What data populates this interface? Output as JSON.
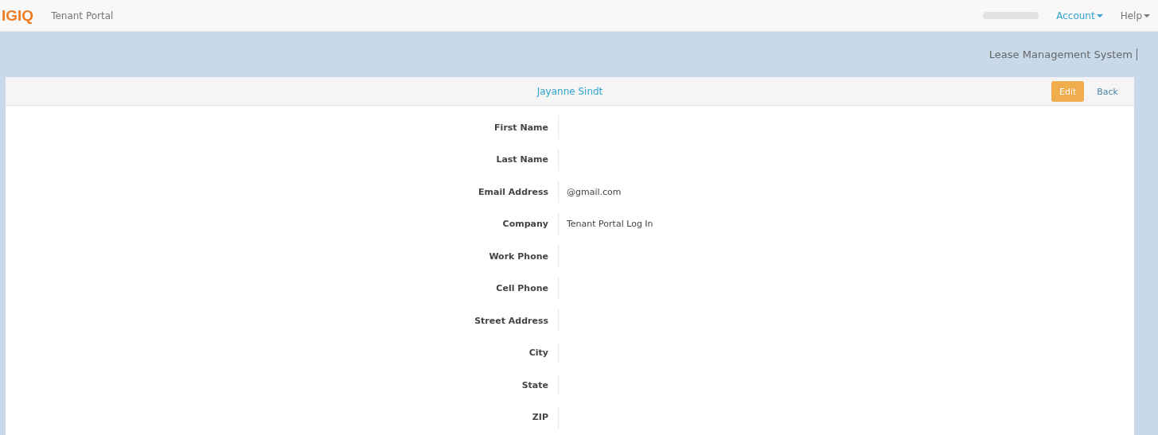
{
  "navbar": {
    "logo": "IGIQ",
    "app_name": "Tenant Portal",
    "menus": [
      {
        "label": "Account",
        "selected": true
      },
      {
        "label": "Help",
        "selected": false
      }
    ]
  },
  "banner": {
    "title": "Lease Management System"
  },
  "panel": {
    "title": "Jayanne Sindt",
    "buttons": [
      {
        "label": "Edit",
        "kind": "primary"
      },
      {
        "label": "Back",
        "kind": "link"
      }
    ],
    "fields": [
      {
        "label": "First Name"
      },
      {
        "label": "Last Name"
      },
      {
        "label": "Email Address",
        "value": "@gmail.com"
      },
      {
        "label": "Company",
        "value": "Tenant Portal Log In"
      },
      {
        "label": "Work Phone"
      },
      {
        "label": "Cell Phone"
      },
      {
        "label": "Street Address"
      },
      {
        "label": "City"
      },
      {
        "label": "State"
      },
      {
        "label": "ZIP"
      }
    ]
  }
}
